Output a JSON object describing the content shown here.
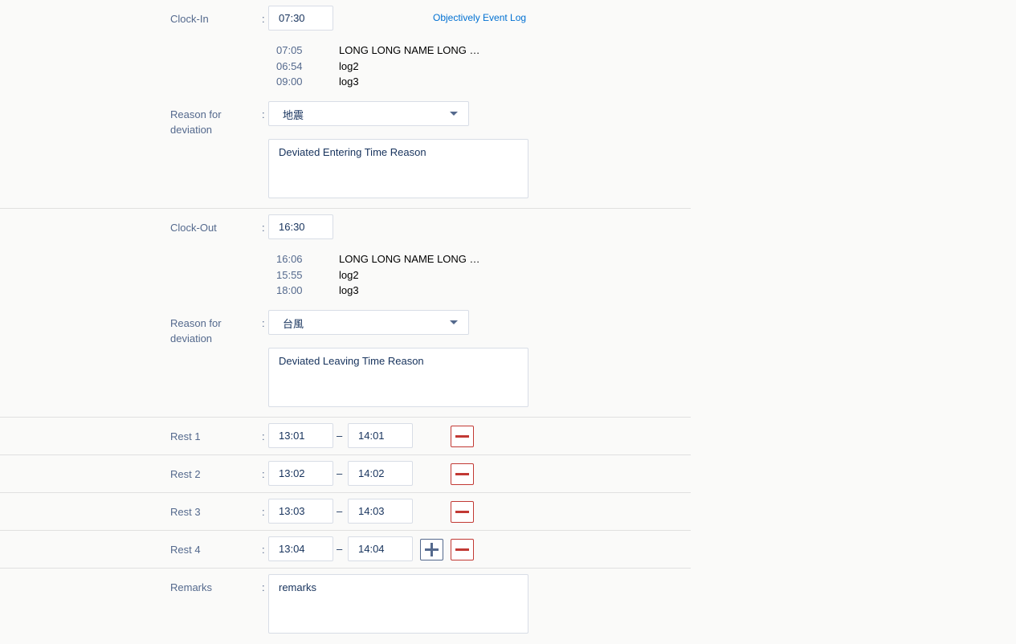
{
  "clock_in": {
    "label": "Clock-In",
    "colon": ":",
    "value": "07:30",
    "event_log_link": "Objectively Event Log",
    "logs": [
      {
        "time": "07:05",
        "name": "LONG LONG NAME LONG LONG NAME"
      },
      {
        "time": "06:54",
        "name": "log2"
      },
      {
        "time": "09:00",
        "name": "log3"
      }
    ],
    "reason_label_line1": "Reason for",
    "reason_label_line2": "deviation",
    "reason_value": "地震",
    "reason_text": "Deviated Entering Time Reason"
  },
  "clock_out": {
    "label": "Clock-Out",
    "colon": ":",
    "value": "16:30",
    "logs": [
      {
        "time": "16:06",
        "name": "LONG LONG NAME LONG LONG NAME"
      },
      {
        "time": "15:55",
        "name": "log2"
      },
      {
        "time": "18:00",
        "name": "log3"
      }
    ],
    "reason_label_line1": "Reason for",
    "reason_label_line2": "deviation",
    "reason_value": "台風",
    "reason_text": "Deviated Leaving Time Reason"
  },
  "rests": [
    {
      "label": "Rest 1",
      "start": "13:01",
      "end": "14:01"
    },
    {
      "label": "Rest 2",
      "start": "13:02",
      "end": "14:02"
    },
    {
      "label": "Rest 3",
      "start": "13:03",
      "end": "14:03"
    },
    {
      "label": "Rest 4",
      "start": "13:04",
      "end": "14:04"
    }
  ],
  "range_separator": "–",
  "remarks": {
    "label": "Remarks",
    "value": "remarks"
  },
  "icons": {
    "add": "plus-icon",
    "remove": "minus-icon",
    "dropdown": "chevron-down-icon"
  },
  "colors": {
    "label": "#54698d",
    "link": "#0070d2",
    "danger": "#c23934",
    "border": "#d8dde6",
    "background": "#fafaf9"
  }
}
